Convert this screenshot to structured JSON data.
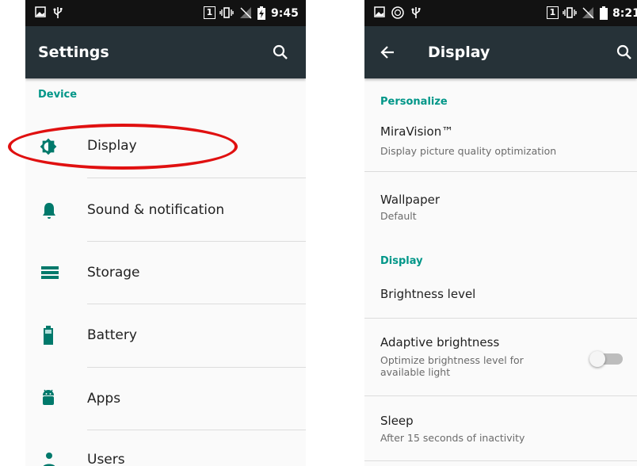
{
  "left": {
    "status": {
      "time": "9:45",
      "sim": "1"
    },
    "appbar": {
      "title": "Settings"
    },
    "section": "Device",
    "items": [
      {
        "label": "Display",
        "icon": "brightness-icon"
      },
      {
        "label": "Sound & notification",
        "icon": "bell-icon"
      },
      {
        "label": "Storage",
        "icon": "storage-icon"
      },
      {
        "label": "Battery",
        "icon": "battery-icon"
      },
      {
        "label": "Apps",
        "icon": "android-icon"
      },
      {
        "label": "Users",
        "icon": "person-icon"
      }
    ]
  },
  "right": {
    "status": {
      "time": "8:21",
      "sim": "1"
    },
    "appbar": {
      "title": "Display"
    },
    "sections": [
      "Personalize",
      "Display"
    ],
    "prefs": [
      {
        "title": "MiraVision™",
        "summary": "Display picture quality optimization"
      },
      {
        "title": "Wallpaper",
        "summary": "Default"
      },
      {
        "title": "Brightness level",
        "summary": ""
      },
      {
        "title": "Adaptive brightness",
        "summary": "Optimize brightness level for available light",
        "toggle_on": false
      },
      {
        "title": "Sleep",
        "summary": "After 15 seconds of inactivity"
      }
    ]
  },
  "colors": {
    "accent": "#009688",
    "appbar": "#263238",
    "statusbar": "#121212",
    "highlight": "#e01010"
  }
}
